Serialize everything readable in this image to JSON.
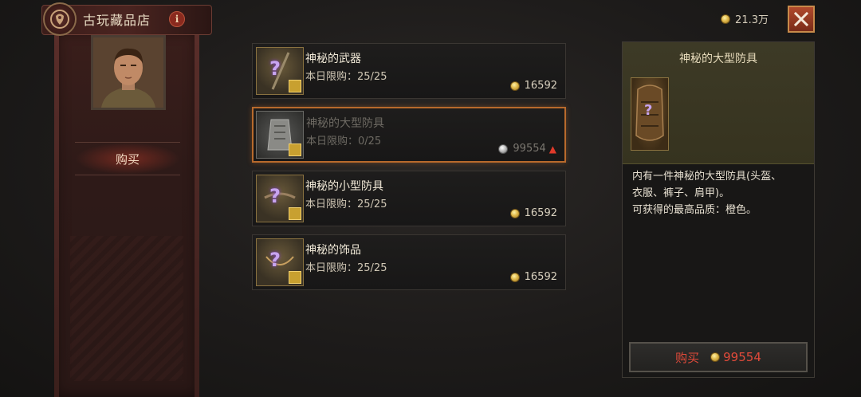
{
  "shop": {
    "title": "古玩藏品店",
    "info_icon_glyph": "i",
    "buy_tab_label": "购买"
  },
  "header": {
    "currency_amount": "21.3万",
    "close_glyph": "✕"
  },
  "items": [
    {
      "name": "神秘的武器",
      "limit": "本日限购：25/25",
      "price": "16592",
      "coin": "gold",
      "selected": false
    },
    {
      "name": "神秘的大型防具",
      "limit": "本日限购：0/25",
      "price": "99554",
      "coin": "silver",
      "selected": true
    },
    {
      "name": "神秘的小型防具",
      "limit": "本日限购：25/25",
      "price": "16592",
      "coin": "gold",
      "selected": false
    },
    {
      "name": "神秘的饰品",
      "limit": "本日限购：25/25",
      "price": "16592",
      "coin": "gold",
      "selected": false
    }
  ],
  "detail": {
    "title": "神秘的大型防具",
    "description_line1": "内有一件神秘的大型防具(头盔、",
    "description_line2": "衣服、裤子、肩甲)。",
    "description_line3": "可获得的最高品质：橙色。",
    "buy_label": "购买",
    "buy_price": "99554"
  },
  "colors": {
    "accent_orange": "#b86a2c",
    "price_red": "#e04a3a",
    "banner_red": "#3a1e1b"
  }
}
